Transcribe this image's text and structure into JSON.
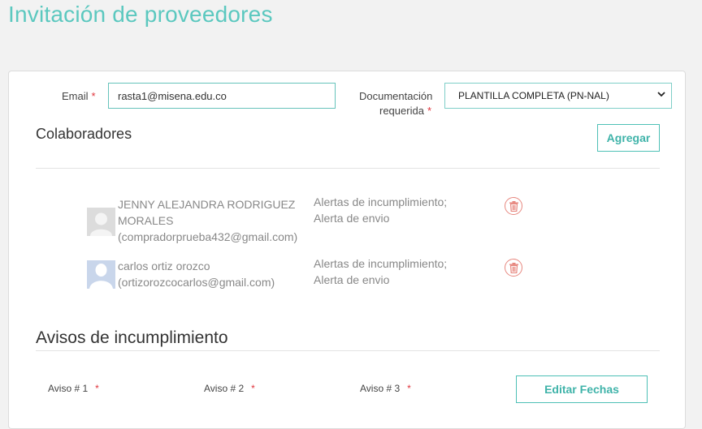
{
  "page": {
    "title": "Invitación de proveedores"
  },
  "form": {
    "email_label": "Email",
    "email_value": "rasta1@misena.edu.co",
    "doc_label_line1": "Documentación",
    "doc_label_line2": "requerida",
    "doc_selected": "PLANTILLA COMPLETA (PN-NAL)",
    "required_mark": "*"
  },
  "colaboradores": {
    "title": "Colaboradores",
    "add_label": "Agregar",
    "items": [
      {
        "name_line1": "JENNY ALEJANDRA RODRIGUEZ",
        "name_line2": "MORALES",
        "email": "(compradorprueba432@gmail.com)",
        "alerts_line1": "Alertas de incumplimiento;",
        "alerts_line2": "Alerta de envio",
        "avatar": "generic-user-icon"
      },
      {
        "name_line1": "carlos ortiz orozco",
        "email": "(ortizorozcocarlos@gmail.com)",
        "alerts_line1": "Alertas de incumplimiento;",
        "alerts_line2": "Alerta de envio",
        "avatar": "user-silhouette-icon"
      }
    ]
  },
  "avisos": {
    "title": "Avisos de incumplimiento",
    "labels": [
      "Aviso # 1",
      "Aviso # 2",
      "Aviso # 3"
    ],
    "edit_label": "Editar Fechas"
  },
  "colors": {
    "accent": "#5bc8bf",
    "required": "#e0323a",
    "delete": "#e7877f"
  }
}
